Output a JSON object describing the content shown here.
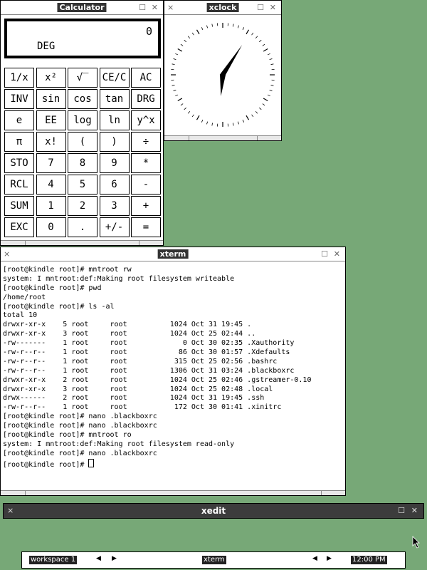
{
  "calculator": {
    "title": "Calculator",
    "display_value": "0",
    "display_mode": "DEG",
    "keys": [
      "1/x",
      "x²",
      "√‾",
      "CE/C",
      "AC",
      "INV",
      "sin",
      "cos",
      "tan",
      "DRG",
      "e",
      "EE",
      "log",
      "ln",
      "y^x",
      "π",
      "x!",
      "(",
      ")",
      "÷",
      "STO",
      "7",
      "8",
      "9",
      "*",
      "RCL",
      "4",
      "5",
      "6",
      "-",
      "SUM",
      "1",
      "2",
      "3",
      "+",
      "EXC",
      "0",
      ".",
      "+/-",
      "="
    ]
  },
  "clock": {
    "title": "xclock"
  },
  "terminal": {
    "title": "xterm",
    "lines": [
      "[root@kindle root]# mntroot rw",
      "system: I mntroot:def:Making root filesystem writeable",
      "[root@kindle root]# pwd",
      "/home/root",
      "[root@kindle root]# ls -al",
      "total 10",
      "drwxr-xr-x    5 root     root          1024 Oct 31 19:45 .",
      "drwxr-xr-x    3 root     root          1024 Oct 25 02:44 ..",
      "-rw-------    1 root     root             0 Oct 30 02:35 .Xauthority",
      "-rw-r--r--    1 root     root            86 Oct 30 01:57 .Xdefaults",
      "-rw-r--r--    1 root     root           315 Oct 25 02:56 .bashrc",
      "-rw-r--r--    1 root     root          1306 Oct 31 03:24 .blackboxrc",
      "drwxr-xr-x    2 root     root          1024 Oct 25 02:46 .gstreamer-0.10",
      "drwxr-xr-x    3 root     root          1024 Oct 25 02:48 .local",
      "drwx------    2 root     root          1024 Oct 31 19:45 .ssh",
      "-rw-r--r--    1 root     root           172 Oct 30 01:41 .xinitrc",
      "[root@kindle root]# nano .blackboxrc",
      "[root@kindle root]# nano .blackboxrc",
      "[root@kindle root]# mntroot ro",
      "system: I mntroot:def:Making root filesystem read-only",
      "[root@kindle root]# nano .blackboxrc",
      "[root@kindle root]# "
    ]
  },
  "xedit": {
    "title": "xedit"
  },
  "toolbar": {
    "workspace_label": "workspace 1",
    "window_label": "xterm",
    "clock_label": "12:00 PM"
  },
  "icons": {
    "iconify": "x-mark-icon",
    "maximize": "square-icon",
    "close": "close-icon"
  }
}
